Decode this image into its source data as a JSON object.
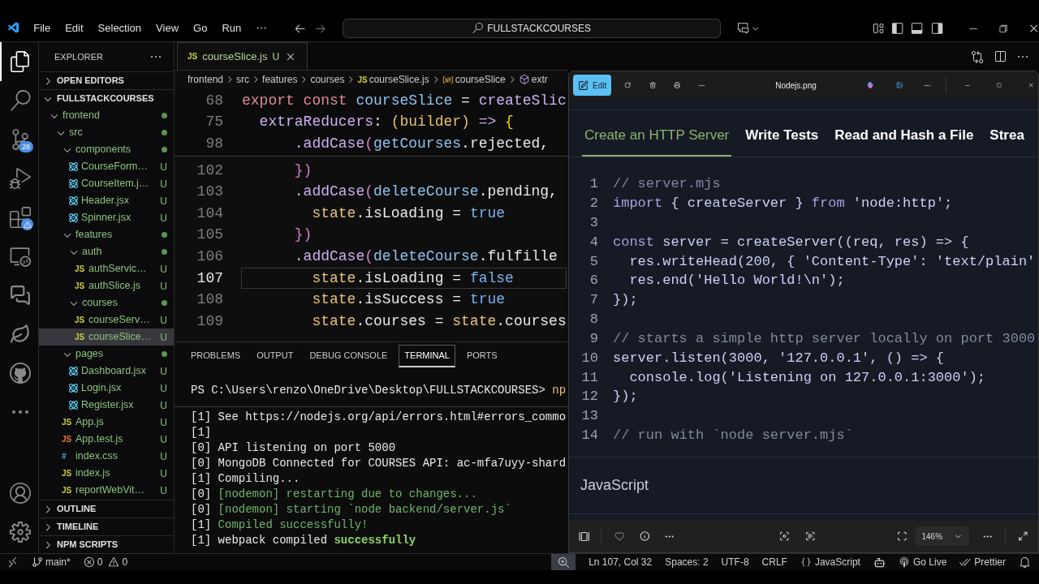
{
  "title_bar": {
    "menu": [
      "File",
      "Edit",
      "Selection",
      "View",
      "Go",
      "Run"
    ],
    "search": "FULLSTACKCOURSES"
  },
  "activity_bar": {
    "top": [
      {
        "kind": "files",
        "selected": true
      },
      {
        "kind": "search",
        "selected": false
      },
      {
        "kind": "source-control",
        "selected": false,
        "badge": "28"
      },
      {
        "kind": "run",
        "selected": false
      },
      {
        "kind": "extensions",
        "selected": false,
        "warning": true
      },
      {
        "kind": "remote",
        "selected": false
      },
      {
        "kind": "chat",
        "selected": false
      },
      {
        "kind": "mongodb",
        "selected": false
      },
      {
        "kind": "github",
        "selected": false
      },
      {
        "kind": "more",
        "selected": false
      }
    ],
    "bottom": [
      {
        "kind": "account",
        "selected": false
      },
      {
        "kind": "settings",
        "selected": false
      }
    ]
  },
  "explorer": {
    "title": "EXPLORER",
    "sections": [
      {
        "title": "OPEN EDITORS",
        "expanded": false
      },
      {
        "title": "FULLSTACKCOURSES",
        "expanded": true,
        "tree": [
          {
            "label": "frontend",
            "kind": "folder",
            "expanded": true,
            "dot": true,
            "selected": false,
            "children": [
              {
                "label": "src",
                "kind": "folder",
                "expanded": true,
                "dot": true,
                "selected": false,
                "children": [
                  {
                    "label": "components",
                    "kind": "folder",
                    "expanded": true,
                    "dot": true,
                    "selected": false,
                    "children": [
                      {
                        "label": "CourseForm…",
                        "kind": "react",
                        "status": "U",
                        "selected": false
                      },
                      {
                        "label": "CourseItem.j…",
                        "kind": "react",
                        "status": "U",
                        "selected": false
                      },
                      {
                        "label": "Header.jsx",
                        "kind": "react",
                        "status": "U",
                        "selected": false
                      },
                      {
                        "label": "Spinner.jsx",
                        "kind": "react",
                        "status": "U",
                        "selected": false
                      }
                    ]
                  },
                  {
                    "label": "features",
                    "kind": "folder",
                    "expanded": true,
                    "dot": true,
                    "selected": false,
                    "children": [
                      {
                        "label": "auth",
                        "kind": "folder",
                        "expanded": true,
                        "dot": true,
                        "selected": false,
                        "children": [
                          {
                            "label": "authServic…",
                            "kind": "file",
                            "type_label": "JS",
                            "color": "#cbcb41",
                            "status": "U",
                            "selected": false
                          },
                          {
                            "label": "authSlice.js",
                            "kind": "file",
                            "type_label": "JS",
                            "color": "#cbcb41",
                            "status": "U",
                            "selected": false
                          }
                        ]
                      },
                      {
                        "label": "courses",
                        "kind": "folder",
                        "expanded": true,
                        "dot": true,
                        "selected": false,
                        "children": [
                          {
                            "label": "courseServ…",
                            "kind": "file",
                            "type_label": "JS",
                            "color": "#cbcb41",
                            "status": "U",
                            "selected": false
                          },
                          {
                            "label": "courseSlice…",
                            "kind": "file",
                            "type_label": "JS",
                            "color": "#cbcb41",
                            "status": "U",
                            "selected": true
                          }
                        ]
                      }
                    ]
                  },
                  {
                    "label": "pages",
                    "kind": "folder",
                    "expanded": true,
                    "dot": true,
                    "selected": false,
                    "children": [
                      {
                        "label": "Dashboard.jsx",
                        "kind": "react",
                        "status": "U",
                        "selected": false
                      },
                      {
                        "label": "Login.jsx",
                        "kind": "react",
                        "status": "U",
                        "selected": false
                      },
                      {
                        "label": "Register.jsx",
                        "kind": "react",
                        "status": "U",
                        "selected": false
                      }
                    ]
                  },
                  {
                    "label": "App.js",
                    "kind": "file",
                    "type_label": "JS",
                    "color": "#cbcb41",
                    "status": "U",
                    "selected": false
                  },
                  {
                    "label": "App.test.js",
                    "kind": "file",
                    "type_label": "JS",
                    "color": "#e37933",
                    "status": "U",
                    "selected": false
                  },
                  {
                    "label": "index.css",
                    "kind": "file",
                    "type_label": "#",
                    "color": "#519aba",
                    "status": "U",
                    "selected": false
                  },
                  {
                    "label": "index.js",
                    "kind": "file",
                    "type_label": "JS",
                    "color": "#cbcb41",
                    "status": "U",
                    "selected": false
                  },
                  {
                    "label": "reportWebVit…",
                    "kind": "file",
                    "type_label": "JS",
                    "color": "#cbcb41",
                    "status": "U",
                    "selected": false
                  }
                ]
              }
            ]
          }
        ]
      },
      {
        "title": "OUTLINE",
        "expanded": false
      },
      {
        "title": "TIMELINE",
        "expanded": false
      },
      {
        "title": "NPM SCRIPTS",
        "expanded": false
      }
    ]
  },
  "editor": {
    "tabs": [
      {
        "label": "courseSlice.js",
        "type_label": "JS",
        "badge": "U",
        "selected": true
      }
    ],
    "breadcrumb": [
      {
        "text": "frontend",
        "kind": "folder"
      },
      {
        "text": "src",
        "kind": "folder"
      },
      {
        "text": "features",
        "kind": "folder"
      },
      {
        "text": "courses",
        "kind": "folder"
      },
      {
        "text": "courseSlice.js",
        "kind": "file",
        "type_label": "JS"
      },
      {
        "text": "courseSlice",
        "kind": "variable"
      },
      {
        "text": "extr",
        "kind": "method"
      }
    ],
    "sticky_lines": [
      {
        "number": "68",
        "current": false,
        "tokens": [
          {
            "text": "export const ",
            "kind": "keyword"
          },
          {
            "text": "courseSlice",
            "kind": "name"
          },
          {
            "text": " = ",
            "kind": "plain"
          },
          {
            "text": "createSlic",
            "kind": "func"
          }
        ]
      },
      {
        "number": "75",
        "current": false,
        "tokens": [
          {
            "text": "  extraReducers",
            "kind": "func"
          },
          {
            "text": ": ",
            "kind": "plain"
          },
          {
            "text": "(builder)",
            "kind": "param"
          },
          {
            "text": " => ",
            "kind": "func"
          },
          {
            "text": "{",
            "kind": "brace"
          }
        ]
      },
      {
        "number": "98",
        "current": false,
        "tokens": [
          {
            "text": "      .addCase",
            "kind": "func"
          },
          {
            "text": "(",
            "kind": "paren"
          },
          {
            "text": "getCourses",
            "kind": "name"
          },
          {
            "text": ".rejected,",
            "kind": "plain"
          }
        ]
      }
    ],
    "lines": [
      {
        "number": "102",
        "current": false,
        "tokens": [
          {
            "text": "      })",
            "kind": "paren"
          }
        ]
      },
      {
        "number": "103",
        "current": false,
        "tokens": [
          {
            "text": "      .addCase",
            "kind": "func"
          },
          {
            "text": "(",
            "kind": "paren"
          },
          {
            "text": "deleteCourse",
            "kind": "name"
          },
          {
            "text": ".pending,",
            "kind": "plain"
          }
        ]
      },
      {
        "number": "104",
        "current": false,
        "tokens": [
          {
            "text": "        state",
            "kind": "state"
          },
          {
            "text": ".isLoading = ",
            "kind": "plain"
          },
          {
            "text": "true",
            "kind": "bool"
          }
        ]
      },
      {
        "number": "105",
        "current": false,
        "tokens": [
          {
            "text": "      })",
            "kind": "paren"
          }
        ]
      },
      {
        "number": "106",
        "current": false,
        "tokens": [
          {
            "text": "      .addCase",
            "kind": "func"
          },
          {
            "text": "(",
            "kind": "paren"
          },
          {
            "text": "deleteCourse",
            "kind": "name"
          },
          {
            "text": ".fulfille",
            "kind": "plain"
          }
        ]
      },
      {
        "number": "107",
        "current": true,
        "tokens": [
          {
            "text": "        state",
            "kind": "state"
          },
          {
            "text": ".isLoading = ",
            "kind": "plain"
          },
          {
            "text": "false",
            "kind": "bool"
          }
        ]
      },
      {
        "number": "108",
        "current": false,
        "tokens": [
          {
            "text": "        state",
            "kind": "state"
          },
          {
            "text": ".isSuccess = ",
            "kind": "plain"
          },
          {
            "text": "true",
            "kind": "bool"
          }
        ]
      },
      {
        "number": "109",
        "current": false,
        "tokens": [
          {
            "text": "        state",
            "kind": "state"
          },
          {
            "text": ".courses = ",
            "kind": "plain"
          },
          {
            "text": "state",
            "kind": "state"
          },
          {
            "text": ".courses",
            "kind": "plain"
          }
        ]
      }
    ]
  },
  "panel": {
    "tabs": [
      {
        "label": "PROBLEMS",
        "selected": false
      },
      {
        "label": "OUTPUT",
        "selected": false
      },
      {
        "label": "DEBUG CONSOLE",
        "selected": false
      },
      {
        "label": "TERMINAL",
        "selected": true
      },
      {
        "label": "PORTS",
        "selected": false
      }
    ],
    "prompt": [
      {
        "text": "PS C:\\Users\\renzo\\OneDrive\\Desktop\\FULLSTACKCOURSES> ",
        "kind": "plain"
      },
      {
        "text": "np",
        "kind": "command"
      }
    ],
    "lines": [
      [
        {
          "text": "[1] See https://nodejs.org/api/errors.html#errors_commo",
          "kind": "plain"
        }
      ],
      [
        {
          "text": "[1]",
          "kind": "plain"
        }
      ],
      [
        {
          "text": "[0] API listening on port 5000",
          "kind": "plain"
        }
      ],
      [
        {
          "text": "[0] MongoDB Connected for COURSES API: ac-mfa7uyy-shard",
          "kind": "plain"
        }
      ],
      [
        {
          "text": "[1] Compiling...",
          "kind": "plain"
        }
      ],
      [
        {
          "text": "[0] ",
          "kind": "plain"
        },
        {
          "text": "[nodemon] restarting due to changes...",
          "kind": "log"
        }
      ],
      [
        {
          "text": "[0] ",
          "kind": "plain"
        },
        {
          "text": "[nodemon] starting `node backend/server.js`",
          "kind": "log"
        }
      ],
      [
        {
          "text": "[1] ",
          "kind": "plain"
        },
        {
          "text": "Compiled successfully!",
          "kind": "log"
        }
      ],
      [
        {
          "text": "[1] webpack compiled ",
          "kind": "plain"
        },
        {
          "text": "successfully",
          "kind": "success"
        }
      ]
    ]
  },
  "viewer": {
    "title": "Nodejs.png",
    "edit": "Edit",
    "zoom": "146%",
    "image": {
      "tabs": [
        {
          "label": "Create an HTTP Server",
          "selected": true
        },
        {
          "label": "Write Tests",
          "selected": false
        },
        {
          "label": "Read and Hash a File",
          "selected": false
        },
        {
          "label": "Strea",
          "selected": false
        }
      ],
      "code": [
        {
          "number": "1",
          "tokens": [
            {
              "text": "// server.mjs",
              "kind": "comment"
            }
          ]
        },
        {
          "number": "2",
          "tokens": [
            {
              "text": "import",
              "kind": "keyword2"
            },
            {
              "text": " { createServer } ",
              "kind": "code"
            },
            {
              "text": "from",
              "kind": "keyword2"
            },
            {
              "text": " 'node:http';",
              "kind": "code"
            }
          ]
        },
        {
          "number": "3"
        },
        {
          "number": "4",
          "tokens": [
            {
              "text": "const",
              "kind": "keyword2"
            },
            {
              "text": " server = createServer((req, res) => {",
              "kind": "code"
            }
          ]
        },
        {
          "number": "5",
          "tokens": [
            {
              "text": "  res.writeHead(200, { 'Content-Type': 'text/plain'",
              "kind": "code"
            }
          ]
        },
        {
          "number": "6",
          "tokens": [
            {
              "text": "  res.end('Hello World!\\n');",
              "kind": "code"
            }
          ]
        },
        {
          "number": "7",
          "tokens": [
            {
              "text": "});",
              "kind": "code"
            }
          ]
        },
        {
          "number": "8"
        },
        {
          "number": "9",
          "tokens": [
            {
              "text": "// starts a simple http server locally on port 3000",
              "kind": "comment"
            }
          ]
        },
        {
          "number": "10",
          "tokens": [
            {
              "text": "server.listen(3000, '127.0.0.1', () => {",
              "kind": "code"
            }
          ]
        },
        {
          "number": "11",
          "tokens": [
            {
              "text": "  console.log('Listening on 127.0.0.1:3000');",
              "kind": "code"
            }
          ]
        },
        {
          "number": "12",
          "tokens": [
            {
              "text": "});",
              "kind": "code"
            }
          ]
        },
        {
          "number": "13"
        },
        {
          "number": "14",
          "tokens": [
            {
              "text": "// run with `node server.mjs`",
              "kind": "comment"
            }
          ]
        }
      ],
      "language": "JavaScript"
    }
  },
  "status_bar": {
    "branch": "main*",
    "errors": "0",
    "warnings": "0",
    "right": [
      {
        "kind": "position",
        "text": "Ln 107, Col 32"
      },
      {
        "kind": "plain",
        "text": "Spaces: 2"
      },
      {
        "kind": "plain",
        "text": "UTF-8"
      },
      {
        "kind": "plain",
        "text": "CRLF"
      },
      {
        "kind": "language",
        "text": "JavaScript"
      },
      {
        "kind": "copilot"
      },
      {
        "kind": "live",
        "text": "Go Live"
      },
      {
        "kind": "prettier",
        "text": "Prettier"
      },
      {
        "kind": "bell"
      }
    ]
  }
}
